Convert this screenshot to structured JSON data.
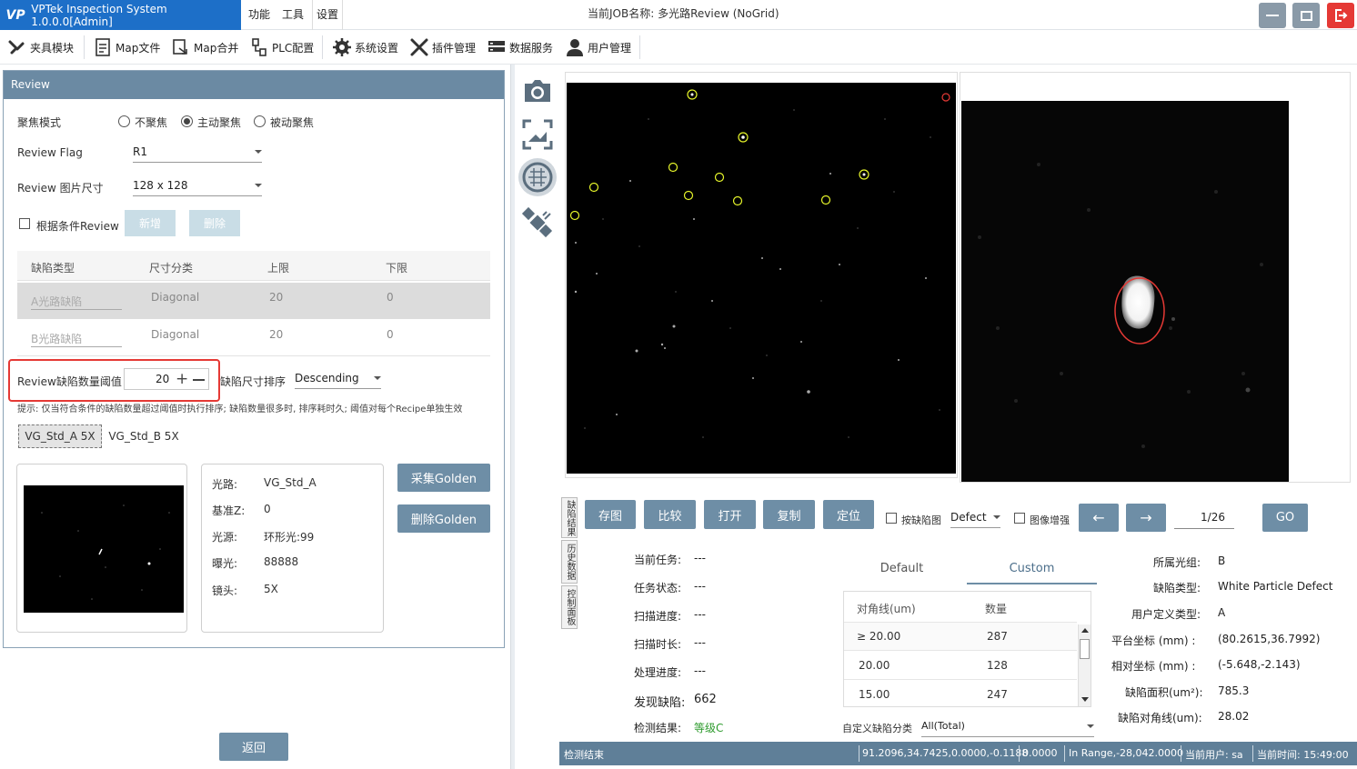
{
  "window": {
    "app_title": "VPTek Inspection System 1.0.0.0[Admin]",
    "logo_text": "VP",
    "menu": [
      "功能",
      "工具",
      "设置"
    ],
    "job_name": "当前JOB名称: 多光路Review (NoGrid)"
  },
  "toolbar": {
    "items": [
      {
        "label": "夹具模块",
        "icon": "gripper-icon"
      },
      {
        "label": "Map文件",
        "icon": "file-icon"
      },
      {
        "label": "Map合并",
        "icon": "merge-icon"
      },
      {
        "label": "PLC配置",
        "icon": "plc-icon"
      },
      {
        "label": "系统设置",
        "icon": "gear-icon"
      },
      {
        "label": "插件管理",
        "icon": "plugin-icon"
      },
      {
        "label": "数据服务",
        "icon": "database-icon"
      },
      {
        "label": "用户管理",
        "icon": "user-icon"
      }
    ]
  },
  "review": {
    "header": "Review",
    "focus_mode_label": "聚焦模式",
    "focus_options": [
      "不聚焦",
      "主动聚焦",
      "被动聚焦"
    ],
    "focus_selected": "主动聚焦",
    "flag_label": "Review Flag",
    "flag_value": "R1",
    "size_label": "Review 图片尺寸",
    "size_value": "128 x 128",
    "conditional_label": "根据条件Review",
    "add_button": "新增",
    "delete_button": "删除",
    "table_headers": [
      "缺陷类型",
      "尺寸分类",
      "上限",
      "下限"
    ],
    "table_rows": [
      {
        "type": "A光路缺陷",
        "size_class": "Diagonal",
        "upper": "20",
        "lower": "0"
      },
      {
        "type": "B光路缺陷",
        "size_class": "Diagonal",
        "upper": "20",
        "lower": "0"
      }
    ],
    "threshold_label": "Review缺陷数量阈值",
    "threshold_value": "20",
    "sort_label": "缺陷尺寸排序",
    "sort_value": "Descending",
    "hint": "提示: 仅当符合条件的缺陷数量超过阈值时执行排序; 缺陷数量很多时, 排序耗时久; 阈值对每个Recipe单独生效",
    "light_tabs": [
      "VG_Std_A 5X",
      "VG_Std_B 5X"
    ],
    "info": {
      "labels": [
        "光路:",
        "基准Z:",
        "光源:",
        "曝光:",
        "镜头:"
      ],
      "values": [
        "VG_Std_A",
        "0",
        "环形光:99",
        "88888",
        "5X"
      ]
    },
    "golden_collect": "采集Golden",
    "golden_delete": "删除Golden",
    "return_button": "返回"
  },
  "side_icons": [
    "camera-icon",
    "image-capture-icon",
    "wafer-map-icon",
    "satellite-icon"
  ],
  "viewer": {
    "vertical_tabs": [
      "缺陷结果",
      "历史数据",
      "控制面板"
    ],
    "actions": [
      "存图",
      "比较",
      "打开",
      "复制",
      "定位"
    ],
    "by_defect_label": "按缺陷图",
    "defect_select": "Defect",
    "enhance_label": "图像增强",
    "prev_arrow": "←",
    "next_arrow": "→",
    "page_indicator": "1/26",
    "go_button": "GO"
  },
  "task": {
    "labels": [
      "当前任务:",
      "任务状态:",
      "扫描进度:",
      "扫描时长:",
      "处理进度:",
      "发现缺陷:",
      "检测结果:"
    ],
    "values": [
      "---",
      "---",
      "---",
      "---",
      "---",
      "662",
      "等级C"
    ]
  },
  "stats": {
    "tab_default": "Default",
    "tab_custom": "Custom",
    "headers": [
      "对角线(um)",
      "数量"
    ],
    "rows": [
      {
        "diag": "≥ 20.00",
        "count": "287"
      },
      {
        "diag": "20.00",
        "count": "128"
      },
      {
        "diag": "15.00",
        "count": "247"
      }
    ],
    "custom_class_label": "自定义缺陷分类",
    "custom_class_value": "All(Total)"
  },
  "defect_info": {
    "labels": [
      "所属光组:",
      "缺陷类型:",
      "用户定义类型:",
      "平台坐标 (mm) :",
      "相对坐标 (mm) :",
      "缺陷面积(um²):",
      "缺陷对角线(um):"
    ],
    "values": [
      "B",
      "White Particle Defect",
      "A",
      "(80.2615,36.7992)",
      "(-5.648,-2.143)",
      "785.3",
      "28.02"
    ]
  },
  "status": {
    "left": "检测结束",
    "coords": "91.2096,34.7425,0.0000,-0.1188",
    "value": "0.0000",
    "range": "In Range,-28,042.0000",
    "user": "当前用户: sa",
    "time": "当前时间: 15:49:00"
  },
  "colors": {
    "brand_blue": "#1d6fc8",
    "panel_header": "#6b8aa3",
    "button_blue": "#6e8ea6",
    "highlight_red": "#e53935",
    "result_green": "#2e9b2e"
  }
}
